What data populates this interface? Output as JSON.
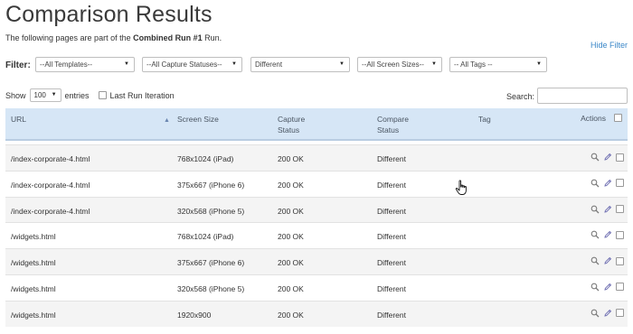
{
  "page": {
    "title": "Comparison Results",
    "subtitle_prefix": "The following pages are part of the ",
    "run_name": "Combined Run #1",
    "subtitle_suffix": " Run.",
    "hide_filter": "Hide Filter"
  },
  "filters": {
    "label": "Filter:",
    "templates": "--All Templates--",
    "capture_statuses": "--All Capture Statuses--",
    "compare_status": "Different",
    "screen_sizes": "--All Screen Sizes--",
    "tags": "-- All Tags --"
  },
  "table_controls": {
    "show_label": "Show",
    "entries_value": "100",
    "entries_label": "entries",
    "last_run_label": "Last Run Iteration",
    "search_label": "Search:",
    "search_value": ""
  },
  "columns": {
    "url": "URL",
    "screen_size": "Screen Size",
    "capture_status_1": "Capture",
    "capture_status_2": "Status",
    "compare_status_1": "Compare",
    "compare_status_2": "Status",
    "tag": "Tag",
    "actions": "Actions"
  },
  "rows": [
    {
      "url": "/index-corporate-4.html",
      "screen_size": "768x1024 (iPad)",
      "capture_status": "200 OK",
      "compare_status": "Different",
      "tag": ""
    },
    {
      "url": "/index-corporate-4.html",
      "screen_size": "375x667 (iPhone 6)",
      "capture_status": "200 OK",
      "compare_status": "Different",
      "tag": ""
    },
    {
      "url": "/index-corporate-4.html",
      "screen_size": "320x568 (iPhone 5)",
      "capture_status": "200 OK",
      "compare_status": "Different",
      "tag": ""
    },
    {
      "url": "/widgets.html",
      "screen_size": "768x1024 (iPad)",
      "capture_status": "200 OK",
      "compare_status": "Different",
      "tag": ""
    },
    {
      "url": "/widgets.html",
      "screen_size": "375x667 (iPhone 6)",
      "capture_status": "200 OK",
      "compare_status": "Different",
      "tag": ""
    },
    {
      "url": "/widgets.html",
      "screen_size": "320x568 (iPhone 5)",
      "capture_status": "200 OK",
      "compare_status": "Different",
      "tag": ""
    },
    {
      "url": "/widgets.html",
      "screen_size": "1920x900",
      "capture_status": "200 OK",
      "compare_status": "Different",
      "tag": ""
    }
  ],
  "icons": {
    "view": "magnifier-icon",
    "edit": "pencil-icon",
    "select": "checkbox",
    "sort": "sort-asc-icon",
    "dropdown": "chevron-down-icon",
    "pointer": "hand-pointer-cursor"
  },
  "colors": {
    "header_bg": "#d6e6f6",
    "link": "#3a87c8",
    "row_alt": "#f4f4f4"
  }
}
